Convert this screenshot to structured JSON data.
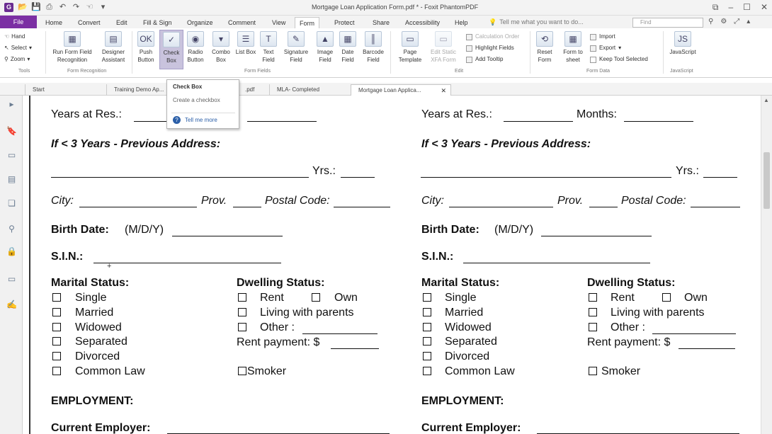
{
  "window": {
    "title": "Mortgage Loan Application Form.pdf * - Foxit PhantomPDF",
    "quick_access": [
      "app-icon",
      "open-icon",
      "save-icon",
      "print-icon",
      "undo-icon",
      "redo-icon",
      "hand-tool-icon",
      "customize-icon"
    ]
  },
  "ribbon_tabs": {
    "file": "File",
    "items": [
      "Home",
      "Convert",
      "Edit",
      "Fill & Sign",
      "Organize",
      "Comment",
      "View",
      "Form",
      "Protect",
      "Share",
      "Accessibility",
      "Help"
    ],
    "active": "Form",
    "tell_me": "Tell me what you want to do...",
    "find_placeholder": "Find"
  },
  "ribbon": {
    "tools": {
      "hand": "Hand",
      "select": "Select",
      "zoom": "Zoom",
      "group": "Tools"
    },
    "form_recognition": {
      "run": "Run Form Field Recognition",
      "designer": "Designer Assistant",
      "group": "Form Recognition"
    },
    "form_fields": {
      "buttons": [
        "Push Button",
        "Check Box",
        "Radio Button",
        "Combo Box",
        "List Box",
        "Text Field",
        "Signature Field",
        "Image Field",
        "Date Field",
        "Barcode Field"
      ],
      "selected": "Check Box",
      "group": "Form Fields"
    },
    "edit": {
      "page_template": "Page Template",
      "edit_static": "Edit Static XFA Form",
      "calculation_order": "Calculation Order",
      "highlight_fields": "Highlight Fields",
      "add_tooltip": "Add Tooltip",
      "group": "Edit"
    },
    "form_data": {
      "reset": "Reset Form",
      "form_to_sheet": "Form to sheet",
      "import": "Import",
      "export": "Export",
      "keep_tool": "Keep Tool Selected",
      "group": "Form Data"
    },
    "javascript": {
      "label": "JavaScript",
      "group": "JavaScript"
    }
  },
  "doc_tabs": [
    "Start",
    "Training Demo Ap...",
    ".pdf",
    "MLA- Completed",
    "Mortgage Loan Applica..."
  ],
  "tooltip": {
    "title": "Check Box",
    "desc": "Create a checkbox",
    "help": "Tell me more"
  },
  "form": {
    "left": {
      "years_at_res": "Years at Res.:",
      "prev_address": "If < 3 Years - Previous Address:",
      "yrs": "Yrs.:",
      "city": "City:",
      "prov": "Prov.",
      "postal": "Postal Code:",
      "birth_date": "Birth Date:",
      "mdy": "(M/D/Y)",
      "sin": "S.I.N.:",
      "marital_status": "Marital Status:",
      "marital_options": [
        "Single",
        "Married",
        "Widowed",
        "Separated",
        "Divorced",
        "Common Law"
      ],
      "dwelling_status": "Dwelling Status:",
      "rent": "Rent",
      "own": "Own",
      "living_with_parents": "Living with parents",
      "other": "Other :",
      "rent_payment": "Rent payment: $",
      "smoker": "Smoker",
      "employment": "EMPLOYMENT:",
      "current_employer": "Current Employer:"
    },
    "right": {
      "years_at_res": "Years at Res.:",
      "months": "Months:",
      "prev_address": "If < 3 Years - Previous Address:",
      "yrs": "Yrs.:",
      "city": "City:",
      "prov": "Prov.",
      "postal": "Postal Code:",
      "birth_date": "Birth Date:",
      "mdy": "(M/D/Y)",
      "sin": "S.I.N.:",
      "marital_status": "Marital Status:",
      "marital_options": [
        "Single",
        "Married",
        "Widowed",
        "Separated",
        "Divorced",
        "Common Law"
      ],
      "dwelling_status": "Dwelling Status:",
      "rent": "Rent",
      "own": "Own",
      "living_with_parents": "Living with parents",
      "other": "Other :",
      "rent_payment": "Rent payment: $",
      "smoker": "Smoker",
      "employment": "EMPLOYMENT:",
      "current_employer": "Current Employer:"
    }
  }
}
